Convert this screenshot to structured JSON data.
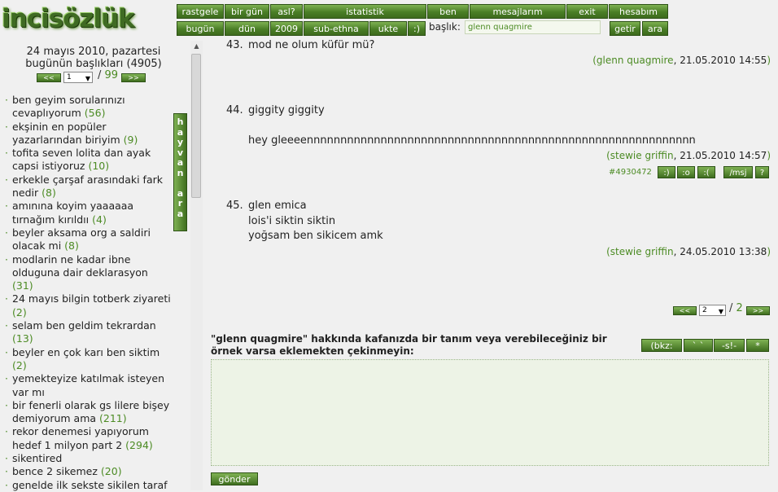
{
  "site": {
    "logo_text": "incisözlük"
  },
  "nav": {
    "row1": [
      "rastgele",
      "bir gün",
      "asl?",
      "istatistik",
      "ben",
      "mesajlarım",
      "exit",
      "hesabım"
    ],
    "row2": [
      "bugün",
      "dün",
      "2009",
      "sub-ethna",
      "ukte",
      ":)"
    ],
    "baslik_label": "başlık:",
    "baslik_value": "glenn quagmire",
    "getir": "getir",
    "ara": "ara"
  },
  "sidebar": {
    "date_line1": "24 mayıs 2010, pazartesi",
    "date_line2": "bugünün başlıkları (4905)",
    "pager": {
      "prev": "<<",
      "next": ">>",
      "current": "1",
      "total": "99"
    },
    "hayvan_ara": "hayvan ara",
    "topics": [
      {
        "title": "ben geyim sorularınızı cevaplıyorum",
        "count": "(56)"
      },
      {
        "title": "ekşinin en popüler yazarlarından biriyim",
        "count": "(9)"
      },
      {
        "title": "tofita seven lolita dan ayak capsi istiyoruz",
        "count": "(10)"
      },
      {
        "title": "erkekle çarşaf arasındaki fark nedir",
        "count": "(8)"
      },
      {
        "title": "amınına koyim yaaaaaa tırnağım kırıldıı",
        "count": "(4)"
      },
      {
        "title": "beyler aksama org a saldiri olacak mi",
        "count": "(8)"
      },
      {
        "title": "modlarin ne kadar ibne olduguna dair deklarasyon",
        "count": "(31)"
      },
      {
        "title": "24 mayıs bilgin totberk ziyareti",
        "count": "(2)"
      },
      {
        "title": "selam ben geldim tekrardan",
        "count": "(13)"
      },
      {
        "title": "beyler en çok karı ben siktim",
        "count": "(2)"
      },
      {
        "title": "yemekteyize katılmak isteyen var mı",
        "count": ""
      },
      {
        "title": "bir fenerli olarak gs lilere bişey demiyorum ama",
        "count": "(211)"
      },
      {
        "title": "rekor denemesi yapıyorum hedef 1 milyon part 2",
        "count": "(294)"
      },
      {
        "title": "sikentired",
        "count": ""
      },
      {
        "title": "bence 2 sikemez",
        "count": "(20)"
      },
      {
        "title": "genelde ilk sekste sikilen taraf",
        "count": ""
      }
    ]
  },
  "entries": [
    {
      "num": "43.",
      "lines": [
        "mod ne olum küfür mü?"
      ],
      "author": "glenn quagmire",
      "date": "21.05.2010 14:55"
    },
    {
      "num": "44.",
      "lines": [
        "giggity giggity",
        "",
        "hey gleeeennnnnnnnnnnnnnnnnnnnnnnnnnnnnnnnnnnnnnnnnnnnnnnnnnnnnnnnnn"
      ],
      "author": "stewie griffin",
      "date": "21.05.2010 14:57"
    },
    {
      "num": "45.",
      "lines": [
        "glen emica",
        "lois'i siktin siktin",
        "yoğsam ben sikicem amk"
      ],
      "author": "stewie griffin",
      "date": "24.05.2010 13:38"
    }
  ],
  "entry_tools": {
    "id": "#4930472",
    "buttons": [
      ":)",
      ":o",
      ":(",
      "/msj",
      "?"
    ]
  },
  "main_pager": {
    "prev": "<<",
    "next": ">>",
    "current": "2",
    "total": "2"
  },
  "add_form": {
    "label": "\"glenn quagmire\" hakkında kafanızda bir tanım veya verebileceğiniz bir örnek varsa eklemekten çekinmeyin:",
    "format_buttons": [
      "(bkz:",
      "` `",
      "-s!-",
      "*"
    ],
    "submit": "gönder"
  }
}
